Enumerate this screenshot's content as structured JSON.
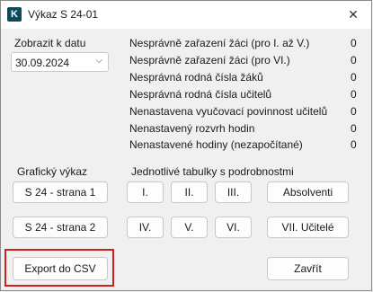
{
  "window": {
    "title": "Výkaz S 24-01",
    "icon_letter": "K",
    "close_glyph": "✕"
  },
  "date": {
    "label": "Zobrazit k datu",
    "value": "30.09.2024",
    "chevron": "⌵"
  },
  "checks": [
    {
      "label": "Nesprávně zařazení žáci (pro I. až V.)",
      "count": "0"
    },
    {
      "label": "Nesprávně zařazení žáci (pro VI.)",
      "count": "0"
    },
    {
      "label": "Nesprávná rodná čísla žáků",
      "count": "0"
    },
    {
      "label": "Nesprávná rodná čísla učitelů",
      "count": "0"
    },
    {
      "label": "Nenastavena vyučovací povinnost učitelů",
      "count": "0"
    },
    {
      "label": "Nenastavený rozvrh hodin",
      "count": "0"
    },
    {
      "label": "Nenastavené hodiny (nezapočítané)",
      "count": "0"
    }
  ],
  "graphic": {
    "heading": "Grafický výkaz",
    "page1": "S 24 - strana 1",
    "page2": "S 24 - strana 2"
  },
  "tables": {
    "heading": "Jednotlivé tabulky s podrobnostmi",
    "t1": "I.",
    "t2": "II.",
    "t3": "III.",
    "absolventi": "Absolventi",
    "t4": "IV.",
    "t5": "V.",
    "t6": "VI.",
    "ucitele": "VII. Učitelé"
  },
  "actions": {
    "export": "Export do CSV",
    "close": "Zavřít"
  },
  "colors": {
    "highlight": "#d11f1f",
    "app_icon": "#0d4b5c"
  }
}
